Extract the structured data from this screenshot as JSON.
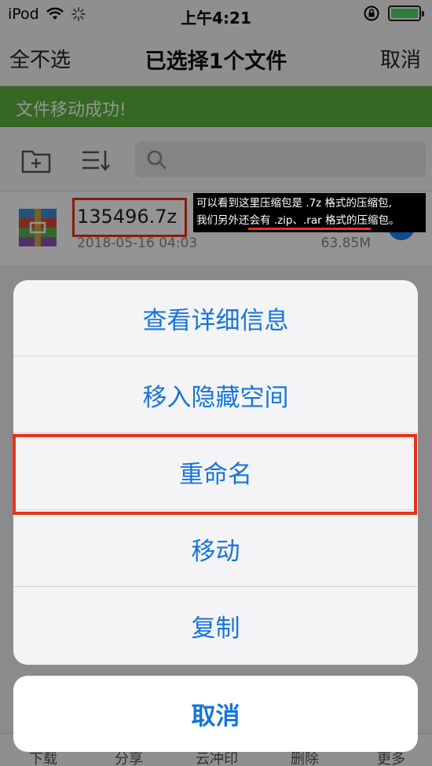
{
  "status_bar": {
    "carrier": "iPod",
    "time": "上午4:21"
  },
  "navbar": {
    "left_button": "全不选",
    "title": "已选择1个文件",
    "right_button": "取消"
  },
  "banner": {
    "text": "文件移动成功!"
  },
  "file": {
    "name": "135496.7z",
    "date": "2018-05-16 04:03",
    "size": "63.85M"
  },
  "annotation": {
    "line1": "可以看到这里压缩包是 .7z 格式的压缩包,",
    "line2": "我们另外还会有 .zip、.rar 格式的压缩包。"
  },
  "action_sheet": {
    "items": [
      "查看详细信息",
      "移入隐藏空间",
      "重命名",
      "移动",
      "复制"
    ],
    "cancel": "取消"
  },
  "tabbar": {
    "items": [
      "下载",
      "分享",
      "云冲印",
      "删除",
      "更多"
    ]
  },
  "colors": {
    "accent": "#1675d8",
    "banner": "#5cb33c",
    "highlight": "#e8331c"
  }
}
